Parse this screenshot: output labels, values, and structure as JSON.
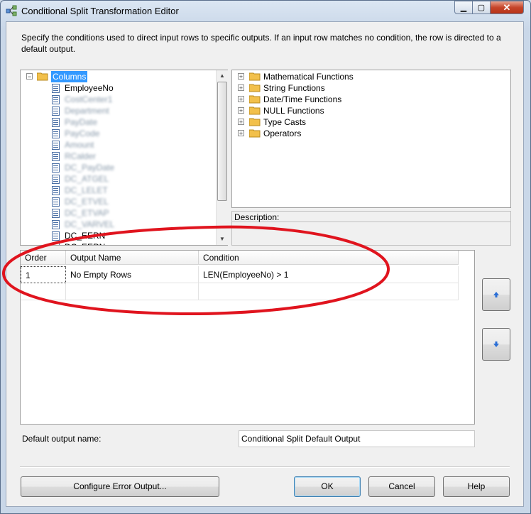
{
  "window": {
    "title": "Conditional Split Transformation Editor",
    "minimize_glyph": "▁",
    "maximize_glyph": "▢",
    "close_glyph": "✕"
  },
  "description": "Specify the conditions used to direct input rows to specific outputs. If an input row matches no condition, the row is directed to a default output.",
  "columns_tree": {
    "root_label": "Columns",
    "items": [
      "EmployeeNo",
      "CostCenter1",
      "Department",
      "PayDate",
      "PayCode",
      "Amount",
      "RCalder",
      "DC_PayDate",
      "DC_ATGEL",
      "DC_LELET",
      "DC_ETVEL",
      "DC_ETVAP",
      "DC_VARVEL",
      "DC_EERN",
      "DC_EERN"
    ],
    "blurred_from": 1,
    "blurred_to": 12
  },
  "functions_tree": {
    "items": [
      "Mathematical Functions",
      "String Functions",
      "Date/Time Functions",
      "NULL Functions",
      "Type Casts",
      "Operators"
    ]
  },
  "description_panel": {
    "label": "Description:"
  },
  "grid": {
    "headers": [
      "Order",
      "Output Name",
      "Condition"
    ],
    "rows": [
      {
        "order": "1",
        "output_name": "No Empty Rows",
        "condition": "LEN(EmployeeNo) > 1"
      }
    ]
  },
  "default_output": {
    "label": "Default output name:",
    "value": "Conditional Split Default Output"
  },
  "buttons": {
    "configure_error_output": "Configure Error Output...",
    "ok": "OK",
    "cancel": "Cancel",
    "help": "Help"
  },
  "colors": {
    "selection": "#3399ff",
    "annotation": "#e0141e",
    "folder": "#f2c04b",
    "arrow": "#2b6fd6"
  }
}
